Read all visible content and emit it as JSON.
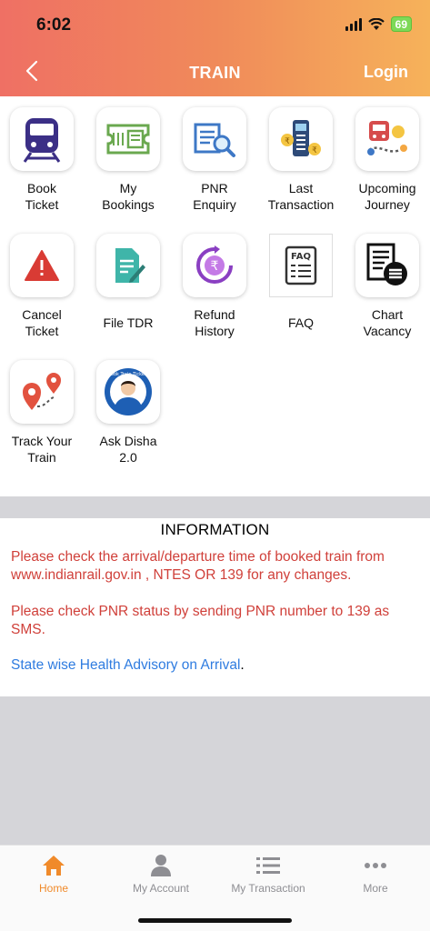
{
  "status_bar": {
    "time": "6:02",
    "battery": "69"
  },
  "header": {
    "title": "TRAIN",
    "login_label": "Login"
  },
  "tiles": [
    {
      "label1": "Book",
      "label2": "Ticket"
    },
    {
      "label1": "My",
      "label2": "Bookings"
    },
    {
      "label1": "PNR",
      "label2": "Enquiry"
    },
    {
      "label1": "Last",
      "label2": "Transaction"
    },
    {
      "label1": "Upcoming",
      "label2": "Journey"
    },
    {
      "label1": "Cancel",
      "label2": "Ticket"
    },
    {
      "label1": "File TDR"
    },
    {
      "label1": "Refund",
      "label2": "History"
    },
    {
      "label1": "FAQ"
    },
    {
      "label1": "Chart",
      "label2": "Vacancy"
    },
    {
      "label1": "Track Your",
      "label2": "Train"
    },
    {
      "label1": "Ask Disha",
      "label2": "2.0"
    }
  ],
  "icon_texts": {
    "faq": "FAQ",
    "disha_badge": "Book Train Tickets"
  },
  "information": {
    "title": "INFORMATION",
    "message1": "Please check the arrival/departure time of booked train from www.indianrail.gov.in , NTES OR 139 for any changes.",
    "message2": "Please check PNR status by sending PNR number to 139 as SMS.",
    "link_text": "State wise Health Advisory on Arrival",
    "link_suffix": "."
  },
  "tabbar": {
    "items": [
      {
        "label": "Home",
        "active": true
      },
      {
        "label": "My Account"
      },
      {
        "label": "My Transaction"
      },
      {
        "label": "More"
      }
    ]
  },
  "colors": {
    "accent": "#f08a2a",
    "alert_text": "#d0403a",
    "link": "#2f7ce0"
  }
}
